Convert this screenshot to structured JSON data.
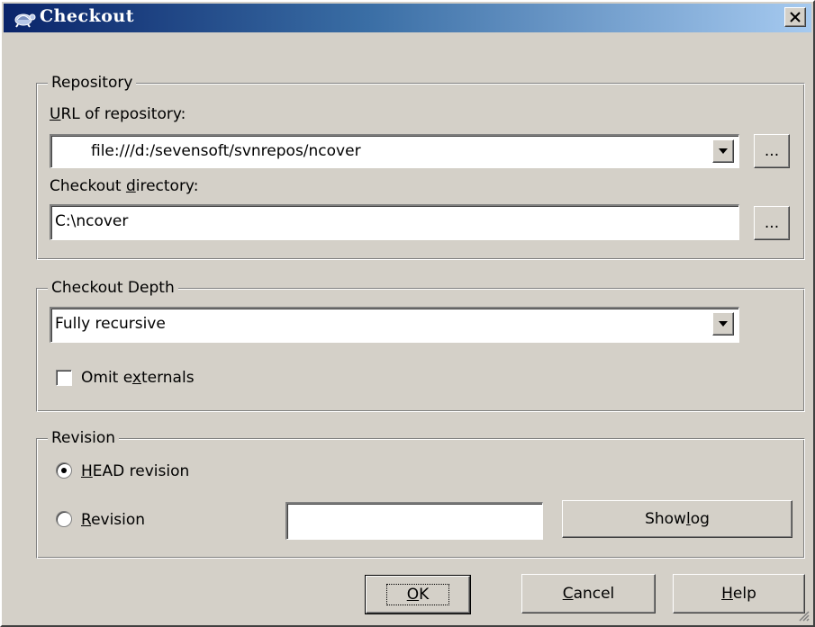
{
  "window": {
    "title": "Checkout",
    "icon": "tortoise-icon",
    "close_label": "X"
  },
  "repository": {
    "legend": "Repository",
    "url_label": "URL of repository:",
    "url_label_accel": "U",
    "url_label_rest": "RL of repository:",
    "url_value": "file:///d:/sevensoft/svnrepos/ncover",
    "browse_label": "...",
    "dir_label_before": "Checkout ",
    "dir_label_accel": "d",
    "dir_label_after": "irectory:",
    "dir_value": "C:\\ncover"
  },
  "depth": {
    "legend": "Checkout Depth",
    "selected": "Fully recursive",
    "omit_before": "Omit e",
    "omit_accel": "x",
    "omit_after": "ternals",
    "omit_checked": false
  },
  "revision": {
    "legend": "Revision",
    "head_accel": "H",
    "head_rest": "EAD revision",
    "head_selected": true,
    "rev_accel": "R",
    "rev_rest": "evision",
    "rev_value": "",
    "show_log_before": "Show ",
    "show_log_accel": "l",
    "show_log_after": "og"
  },
  "buttons": {
    "ok_accel": "O",
    "ok_rest": "K",
    "cancel_accel": "C",
    "cancel_rest": "ancel",
    "help_accel": "H",
    "help_rest": "elp"
  }
}
